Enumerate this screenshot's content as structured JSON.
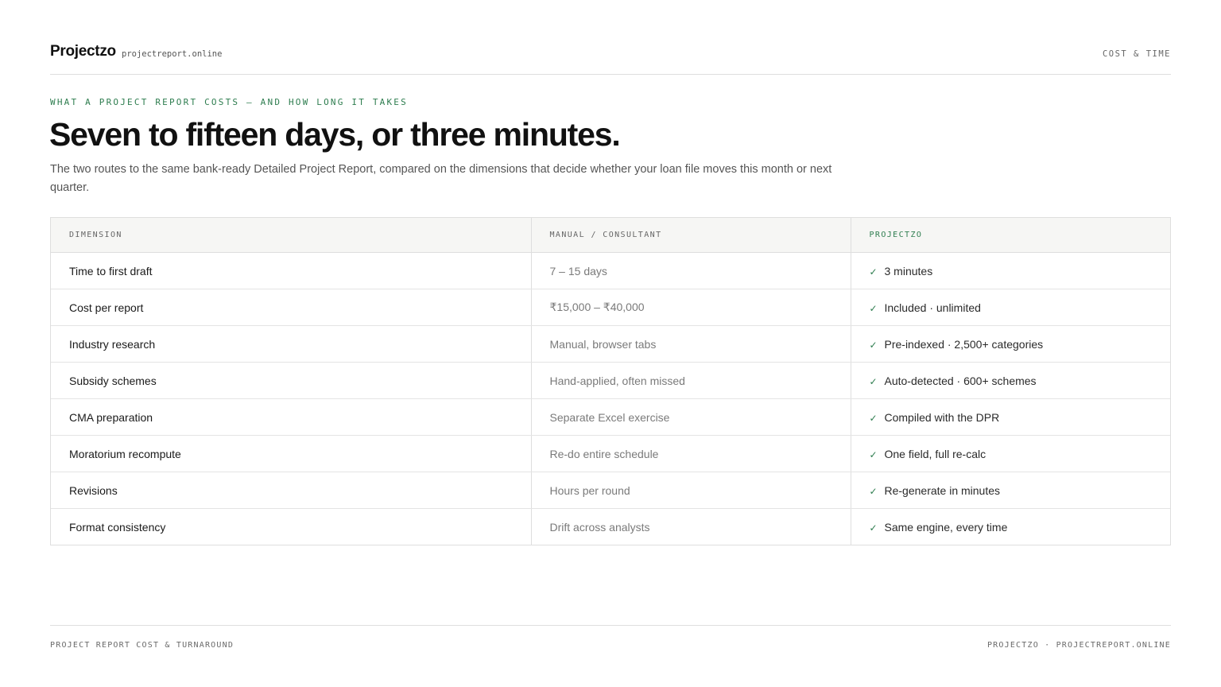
{
  "header": {
    "brand": "Projectzo",
    "domain": "projectreport.online",
    "section": "COST & TIME"
  },
  "hero": {
    "eyebrow": "WHAT A PROJECT REPORT COSTS — AND HOW LONG IT TAKES",
    "headline": "Seven to fifteen days, or three minutes.",
    "lede": "The two routes to the same bank-ready Detailed Project Report, compared on the dimensions that decide whether your loan file moves this month or next quarter."
  },
  "comparison": {
    "columns": [
      "DIMENSION",
      "MANUAL / CONSULTANT",
      "PROJECTZO"
    ],
    "check_icon": "check-icon",
    "rows": [
      {
        "dimension": "Time to first draft",
        "manual": "7 – 15 days",
        "projectzo": "3 minutes"
      },
      {
        "dimension": "Cost per report",
        "manual": "₹15,000 – ₹40,000",
        "projectzo": "Included · unlimited"
      },
      {
        "dimension": "Industry research",
        "manual": "Manual, browser tabs",
        "projectzo": "Pre-indexed · 2,500+ categories"
      },
      {
        "dimension": "Subsidy schemes",
        "manual": "Hand-applied, often missed",
        "projectzo": "Auto-detected · 600+ schemes"
      },
      {
        "dimension": "CMA preparation",
        "manual": "Separate Excel exercise",
        "projectzo": "Compiled with the DPR"
      },
      {
        "dimension": "Moratorium recompute",
        "manual": "Re-do entire schedule",
        "projectzo": "One field, full re-calc"
      },
      {
        "dimension": "Revisions",
        "manual": "Hours per round",
        "projectzo": "Re-generate in minutes"
      },
      {
        "dimension": "Format consistency",
        "manual": "Drift across analysts",
        "projectzo": "Same engine, every time"
      }
    ]
  },
  "footer": {
    "left": "PROJECT REPORT COST & TURNAROUND",
    "right": "PROJECTZO · PROJECTREPORT.ONLINE"
  },
  "colors": {
    "accent": "#2e7d4f",
    "text": "#1a1a1a",
    "muted": "#7a7a7a",
    "border": "#dedede",
    "header_bg": "#f6f6f4"
  }
}
